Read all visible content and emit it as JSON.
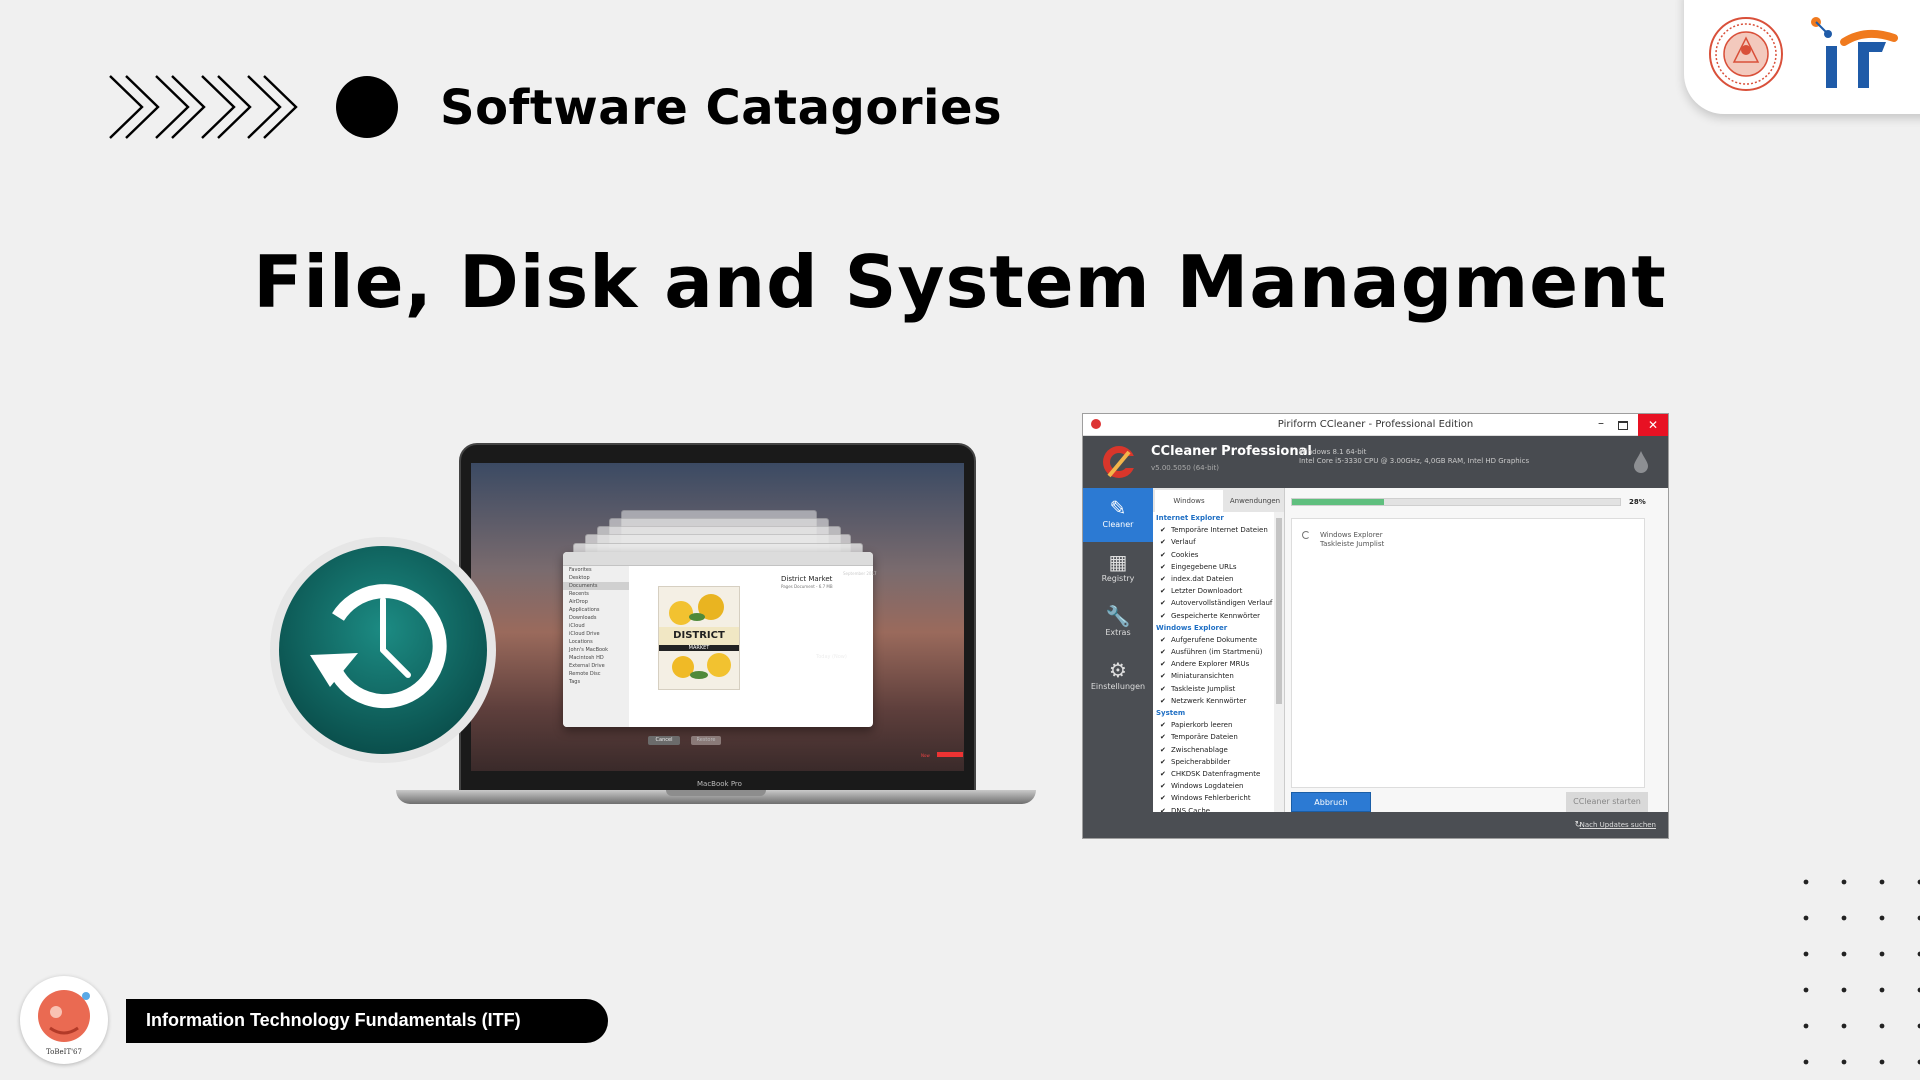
{
  "header": {
    "section_label": "Software Catagories",
    "main_title": "File, Disk and System Managment"
  },
  "laptop": {
    "model_label": "MacBook Pro",
    "finder": {
      "sidebar_items": [
        "Favorites",
        "Desktop",
        "Documents",
        "Recents",
        "AirDrop",
        "Applications",
        "Downloads",
        "iCloud",
        "iCloud Drive",
        "Locations",
        "John's MacBook",
        "Macintosh HD",
        "External Drive",
        "Remote Disc",
        "Tags"
      ],
      "preview_title": "District Market",
      "preview_subtitle": "Pages Document - 6.7 MB",
      "cover_word1": "DISTRICT",
      "cover_word2": "MARKET",
      "cancel_label": "Cancel",
      "restore_label": "Restore",
      "today_label": "Today (Now)",
      "timeline_label": "September 2017",
      "now_label": "Now"
    }
  },
  "ccleaner": {
    "window_title": "Piriform CCleaner - Professional Edition",
    "product_name": "CCleaner Professional",
    "version": "v5.00.5050 (64-bit)",
    "system_line1": "Windows 8.1 64-bit",
    "system_line2": "Intel Core i5-3330 CPU @ 3.00GHz, 4,0GB RAM, Intel HD Graphics",
    "nav": [
      {
        "label": "Cleaner",
        "icon": "broom-icon"
      },
      {
        "label": "Registry",
        "icon": "registry-icon"
      },
      {
        "label": "Extras",
        "icon": "wrench-icon"
      },
      {
        "label": "Einstellungen",
        "icon": "gear-icon"
      }
    ],
    "tabs": [
      "Windows",
      "Anwendungen"
    ],
    "groups": [
      {
        "name": "Internet Explorer",
        "items": [
          "Temporäre Internet Dateien",
          "Verlauf",
          "Cookies",
          "Eingegebene URLs",
          "index.dat Dateien",
          "Letzter Downloadort",
          "Autovervollständigen Verlauf",
          "Gespeicherte Kennwörter"
        ]
      },
      {
        "name": "Windows Explorer",
        "items": [
          "Aufgerufene Dokumente",
          "Ausführen (im Startmenü)",
          "Andere Explorer MRUs",
          "Miniaturansichten",
          "Taskleiste Jumplist",
          "Netzwerk Kennwörter"
        ]
      },
      {
        "name": "System",
        "items": [
          "Papierkorb leeren",
          "Temporäre Dateien",
          "Zwischenablage",
          "Speicherabbilder",
          "CHKDSK Datenfragmente",
          "Windows Logdateien",
          "Windows Fehlerbericht",
          "DNS Cache"
        ]
      }
    ],
    "progress_percent": 28,
    "progress_label": "28%",
    "result_line1": "Windows Explorer",
    "result_line2": "Taskleiste Jumplist",
    "abort_label": "Abbruch",
    "start_label": "CCleaner starten",
    "update_link": "Nach Updates suchen"
  },
  "footer": {
    "course_label": "Information Technology Fundamentals (ITF)",
    "avatar_caption": "ToBeIT'67"
  },
  "colors": {
    "background": "#f0f0f0",
    "it_blue": "#1f5ba8",
    "it_orange": "#f07a1e",
    "seal_red": "#d9503a",
    "cc_blue": "#2c7ad3",
    "cc_green": "#5fbf7e",
    "tm_teal": "#0f6e69"
  }
}
